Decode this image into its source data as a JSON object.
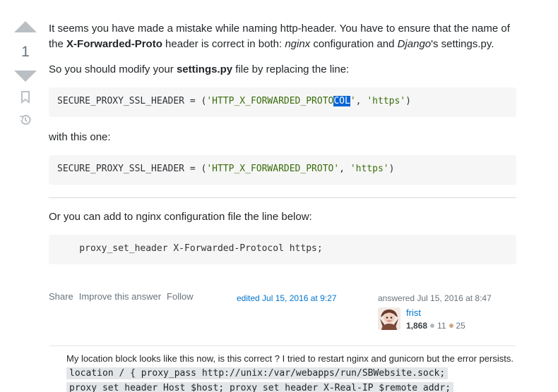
{
  "vote": {
    "count": "1"
  },
  "answer": {
    "p1_a": "It seems you have made a mistake while naming http-header. You have to ensure that the name of the ",
    "p1_b": "X-Forwarded-Proto",
    "p1_c": " header is correct in both: ",
    "p1_d": "nginx",
    "p1_e": " configuration and ",
    "p1_f": "Django",
    "p1_g": "'s settings.py.",
    "p2_a": "So you should modify your ",
    "p2_b": "settings.py",
    "p2_c": " file by replacing the line:",
    "code1_a": "SECURE_PROXY_SSL_HEADER = (",
    "code1_b": "'HTTP_X_FORWARDED_PROTO",
    "code1_sel": "COL",
    "code1_c": "'",
    "code1_d": ", ",
    "code1_e": "'https'",
    "code1_f": ")",
    "p3": "with this one:",
    "code2_a": "SECURE_PROXY_SSL_HEADER = (",
    "code2_b": "'HTTP_X_FORWARDED_PROTO'",
    "code2_c": ", ",
    "code2_d": "'https'",
    "code2_e": ")",
    "p4": "Or you can add to nginx configuration file the line below:",
    "code3": "    proxy_set_header X-Forwarded-Protocol https;"
  },
  "menu": {
    "share": "Share",
    "improve": "Improve this answer",
    "follow": "Follow"
  },
  "edited": "edited Jul 15, 2016 at 9:27",
  "user": {
    "action": "answered Jul 15, 2016 at 8:47",
    "name": "frist",
    "rep": "1,868",
    "silver": "11",
    "bronze": "25",
    "silver_color": "#b4b8bc",
    "bronze_color": "#d1a684"
  },
  "comment": {
    "text": "My location block looks like this now, is this correct ? I tried to restart nginx and gunicorn but the error persists. ",
    "code_line1": "location / { proxy_pass http://unix:/var/webapps/run/SBWebsite.sock;",
    "code_line2": "proxy_set_header Host $host; proxy_set_header X-Real-IP $remote_addr;"
  }
}
